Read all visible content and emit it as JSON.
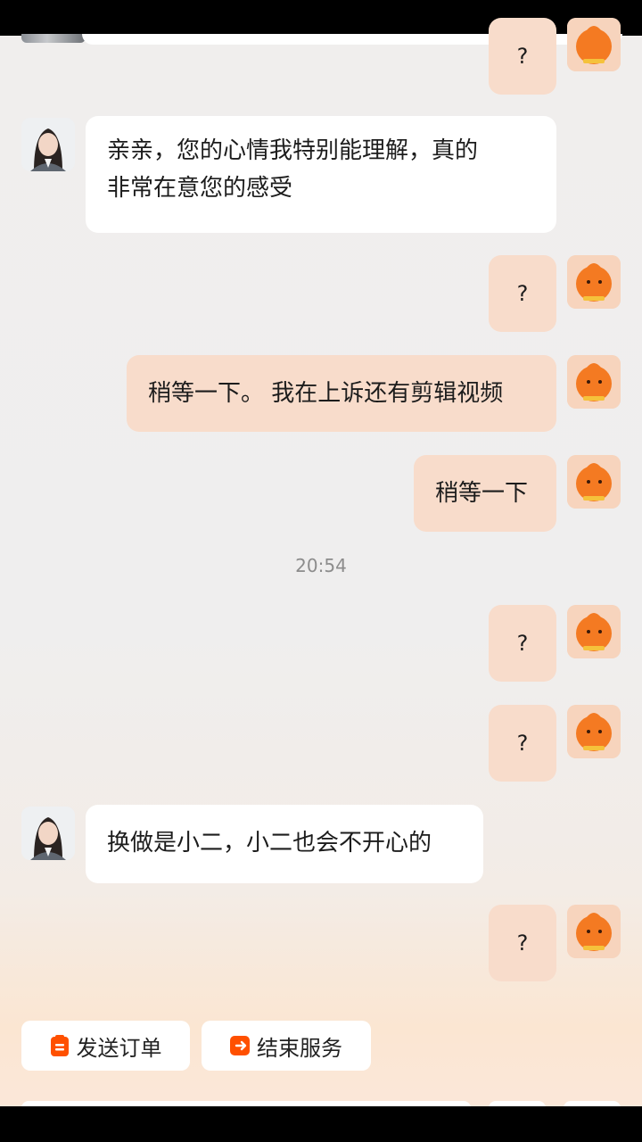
{
  "messages": [
    {
      "from": "user",
      "text": "?"
    },
    {
      "from": "agent",
      "text": "亲亲，您的心情我特别能理解，真的非常在意您的感受"
    },
    {
      "from": "user",
      "text": "?"
    },
    {
      "from": "user",
      "text": "稍等一下。 我在上诉还有剪辑视频"
    },
    {
      "from": "user",
      "text": "稍等一下"
    },
    {
      "from": "user",
      "text": "?"
    },
    {
      "from": "user",
      "text": "?"
    },
    {
      "from": "agent",
      "text": "换做是小二，小二也会不开心的"
    },
    {
      "from": "user",
      "text": "?"
    }
  ],
  "agent_message_1_lines": [
    "亲亲，您的心情我特别能理解，真的",
    "非常在意您的感受"
  ],
  "timestamp": "20:54",
  "actions": {
    "send_order": "发送订单",
    "end_service": "结束服务"
  },
  "icons": {
    "agent_avatar": "customer-service-agent-avatar",
    "user_avatar": "orange-mascot-avatar",
    "send_order": "order-clipboard-icon",
    "end_service": "exit-icon"
  },
  "colors": {
    "incoming_bubble": "#ffffff",
    "outgoing_bubble": "#f8dccb",
    "accent": "#ff5000"
  }
}
